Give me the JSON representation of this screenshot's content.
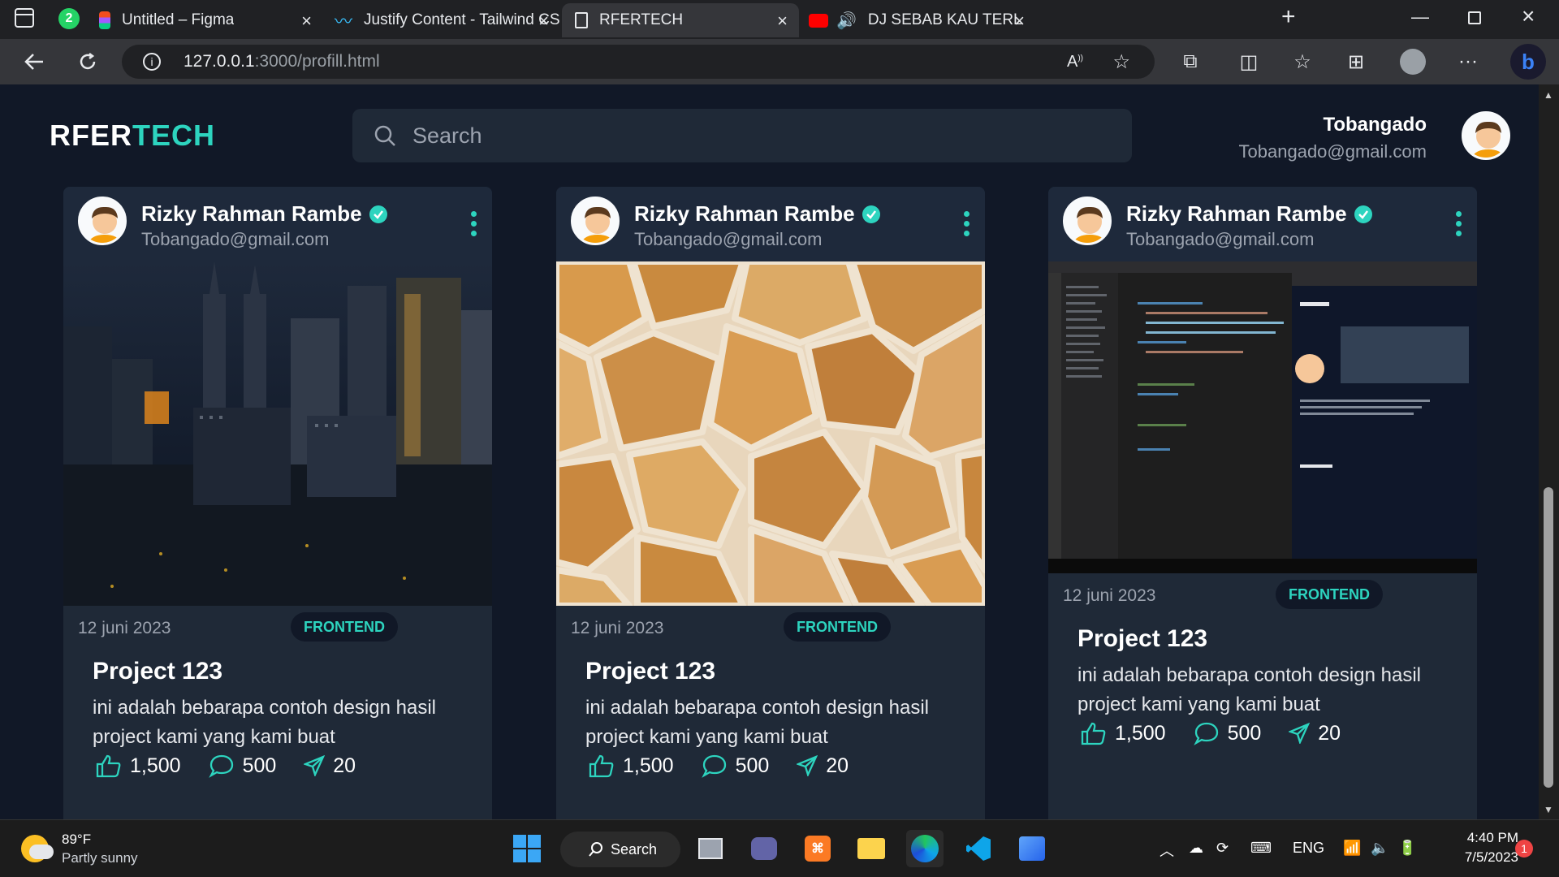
{
  "browser": {
    "tabs": [
      {
        "title": "Untitled – Figma"
      },
      {
        "title": "Justify Content - Tailwind CSS"
      },
      {
        "title": "RFERTECH"
      },
      {
        "title": "DJ SEBAB KAU TERLALU IND"
      }
    ],
    "badge_count": "2",
    "url_host": "127.0.0.1",
    "url_path": ":3000/profill.html"
  },
  "header": {
    "logo_main": "RFER",
    "logo_accent": "TECH",
    "search_placeholder": "Search",
    "user_name": "Tobangado",
    "user_email": "Tobangado@gmail.com"
  },
  "cards": [
    {
      "author": "Rizky Rahman Rambe",
      "email": "Tobangado@gmail.com",
      "image": "city-skyline-night",
      "date": "12 juni 2023",
      "tag": "FRONTEND",
      "title": "Project 123",
      "desc": "ini adalah bebarapa contoh design hasil project kami yang kami buat",
      "likes": "1,500",
      "comments": "500",
      "shares": "20"
    },
    {
      "author": "Rizky Rahman Rambe",
      "email": "Tobangado@gmail.com",
      "image": "stone-texture",
      "date": "12 juni 2023",
      "tag": "FRONTEND",
      "title": "Project 123",
      "desc": "ini adalah bebarapa contoh design hasil project kami yang kami buat",
      "likes": "1,500",
      "comments": "500",
      "shares": "20"
    },
    {
      "author": "Rizky Rahman Rambe",
      "email": "Tobangado@gmail.com",
      "image": "vscode-screenshot",
      "date": "12 juni 2023",
      "tag": "FRONTEND",
      "title": "Project 123",
      "desc": "ini adalah bebarapa contoh design hasil project kami yang kami buat",
      "likes": "1,500",
      "comments": "500",
      "shares": "20"
    }
  ],
  "taskbar": {
    "weather_temp": "89°F",
    "weather_desc": "Partly sunny",
    "search_label": "Search",
    "language": "ENG",
    "time": "4:40 PM",
    "date": "7/5/2023",
    "notifications": "1"
  },
  "colors": {
    "accent": "#2dd4bf",
    "card": "#1f2937",
    "page": "#111827"
  }
}
